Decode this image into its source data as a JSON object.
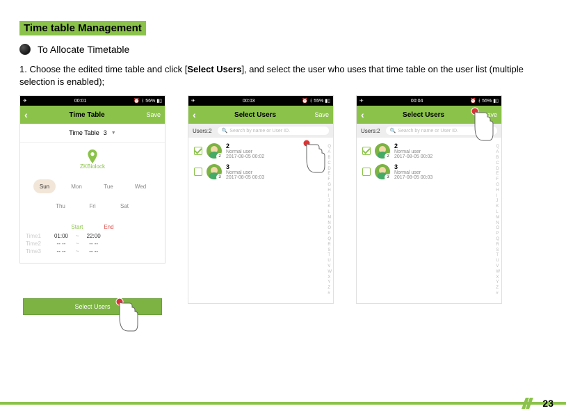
{
  "doc": {
    "section_title": "Time table Management",
    "subsection": "To Allocate Timetable",
    "instruction_prefix": "1. Choose the edited time table and click [",
    "instruction_bold": "Select Users",
    "instruction_suffix": "], and select the user who uses that time table on the user list (multiple selection is enabled);",
    "page_number": "23"
  },
  "screen1": {
    "status_time": "00:01",
    "status_battery": "56%",
    "header_title": "Time Table",
    "save": "Save",
    "tt_label": "Time Table",
    "tt_value": "3",
    "biolock": "ZKBiolock",
    "days": [
      "Sun",
      "Mon",
      "Tue",
      "Wed",
      "Thu",
      "Fri",
      "Sat"
    ],
    "time_header_start": "Start",
    "time_header_end": "End",
    "rows": [
      {
        "label": "Time1",
        "start": "01:00",
        "end": "22:00"
      },
      {
        "label": "Time2",
        "start": "-- --",
        "end": "-- --"
      },
      {
        "label": "Time3",
        "start": "-- --",
        "end": "-- --"
      }
    ],
    "select_users_btn": "Select Users"
  },
  "screen2": {
    "status_time": "00:03",
    "status_battery": "55%",
    "header_title": "Select Users",
    "save": "Save",
    "users_count": "Users:2",
    "search_placeholder": "Search by name or User ID.",
    "users": [
      {
        "id": "2",
        "role": "Normal user",
        "ts": "2017-08-05 00:02",
        "badge": "2",
        "checked": true
      },
      {
        "id": "3",
        "role": "Normal user",
        "ts": "2017-08-05 00:03",
        "badge": "3",
        "checked": false
      }
    ],
    "alpha": [
      "Q",
      "A",
      "B",
      "C",
      "D",
      "E",
      "F",
      "G",
      "H",
      "I",
      "J",
      "K",
      "L",
      "M",
      "N",
      "O",
      "P",
      "Q",
      "R",
      "S",
      "T",
      "U",
      "V",
      "W",
      "X",
      "Y",
      "Z",
      "#"
    ]
  },
  "screen3": {
    "status_time": "00:04",
    "status_battery": "55%",
    "header_title": "Select Users",
    "save": "Save",
    "users_count": "Users:2",
    "search_placeholder": "Search by name or User ID.",
    "users": [
      {
        "id": "2",
        "role": "Normal user",
        "ts": "2017-08-05 00:02",
        "badge": "2",
        "checked": true
      },
      {
        "id": "3",
        "role": "Normal user",
        "ts": "2017-08-05 00:03",
        "badge": "3",
        "checked": false
      }
    ],
    "alpha": [
      "Q",
      "A",
      "B",
      "C",
      "D",
      "E",
      "F",
      "G",
      "H",
      "I",
      "J",
      "K",
      "L",
      "M",
      "N",
      "O",
      "P",
      "Q",
      "R",
      "S",
      "T",
      "U",
      "V",
      "W",
      "X",
      "Y",
      "Z",
      "#"
    ]
  }
}
